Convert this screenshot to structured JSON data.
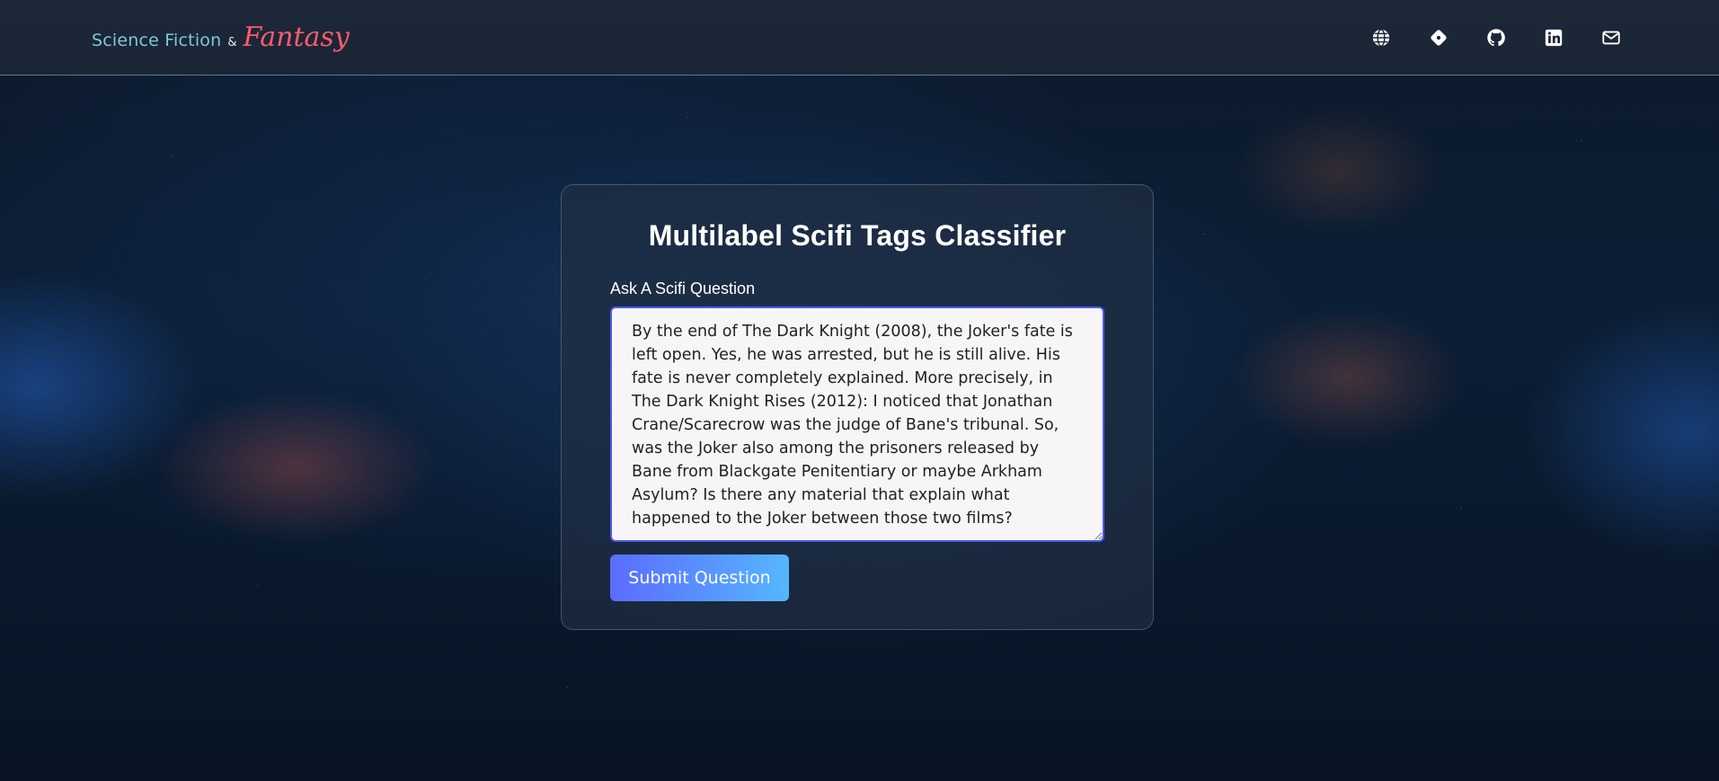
{
  "header": {
    "brand_primary": "Science Fiction",
    "brand_amp": "&",
    "brand_secondary": "Fantasy",
    "icons": [
      "globe-icon",
      "diamond-icon",
      "github-icon",
      "linkedin-icon",
      "mail-icon"
    ]
  },
  "main": {
    "title": "Multilabel Scifi Tags Classifier",
    "question_label": "Ask A Scifi Question",
    "question_value": "By the end of The Dark Knight (2008), the Joker's fate is left open. Yes, he was arrested, but he is still alive. His fate is never completely explained. More precisely, in The Dark Knight Rises (2012): I noticed that Jonathan Crane/Scarecrow was the judge of Bane's tribunal. So, was the Joker also among the prisoners released by Bane from Blackgate Penitentiary or maybe Arkham Asylum? Is there any material that explain what happened to the Joker between those two films?",
    "submit_label": "Submit Question"
  },
  "colors": {
    "accent": "#4e59f0",
    "button_start": "#5b6cff",
    "button_end": "#55b6ff",
    "brand_cyan": "#7fc8d8",
    "brand_pink": "#ff5c6d"
  }
}
